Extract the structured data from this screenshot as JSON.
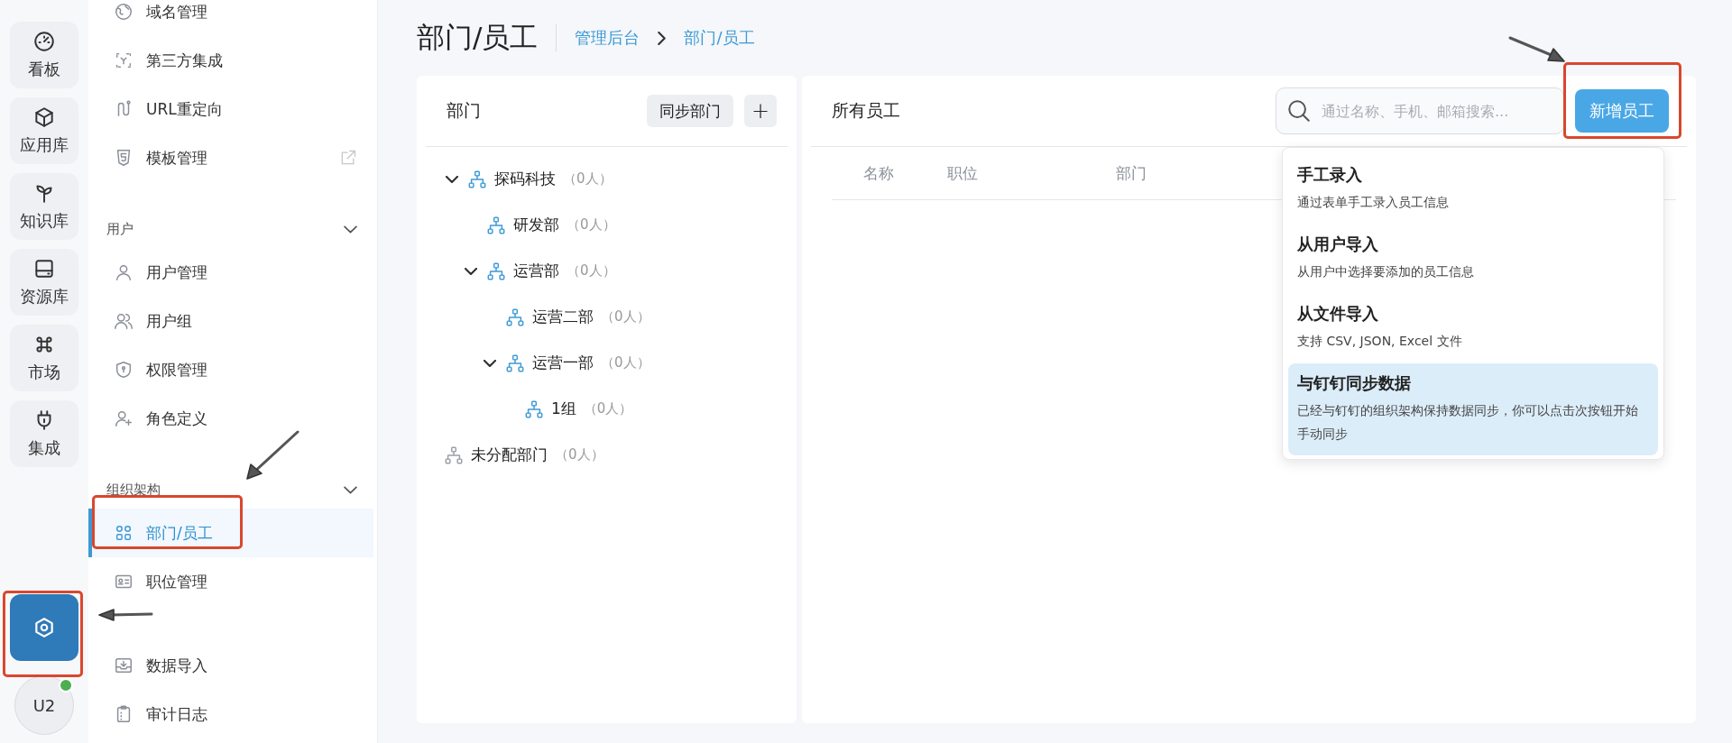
{
  "rail": {
    "items": [
      {
        "label": "看板",
        "selected": false
      },
      {
        "label": "应用库",
        "selected": false
      },
      {
        "label": "知识库",
        "selected": false
      },
      {
        "label": "资源库",
        "selected": false
      },
      {
        "label": "市场",
        "selected": false
      },
      {
        "label": "集成",
        "selected": false
      }
    ],
    "settings": {
      "selected": true
    },
    "avatar": {
      "initials": "U2",
      "online": true
    }
  },
  "sidebar": {
    "sections": [
      {
        "items": [
          {
            "label": "域名管理",
            "selected": false,
            "external": false
          },
          {
            "label": "第三方集成",
            "selected": false,
            "external": false
          },
          {
            "label": "URL重定向",
            "selected": false,
            "external": false
          },
          {
            "label": "模板管理",
            "selected": false,
            "external": true
          }
        ]
      },
      {
        "title": "用户",
        "expanded": true,
        "items": [
          {
            "label": "用户管理",
            "selected": false,
            "external": false
          },
          {
            "label": "用户组",
            "selected": false,
            "external": false
          },
          {
            "label": "权限管理",
            "selected": false,
            "external": false
          },
          {
            "label": "角色定义",
            "selected": false,
            "external": false
          }
        ]
      },
      {
        "title": "组织架构",
        "expanded": true,
        "items": [
          {
            "label": "部门/员工",
            "selected": true,
            "external": false
          },
          {
            "label": "职位管理",
            "selected": false,
            "external": false
          }
        ]
      },
      {
        "items": [
          {
            "label": "数据导入",
            "selected": false,
            "external": false
          },
          {
            "label": "审计日志",
            "selected": false,
            "external": false
          }
        ]
      }
    ]
  },
  "page": {
    "title": "部门/员工",
    "breadcrumb": [
      "管理后台",
      "部门/员工"
    ]
  },
  "departments": {
    "title": "部门",
    "sync_button": "同步部门",
    "add_button": "+",
    "tree": [
      {
        "kind": "department",
        "name": "探码科技",
        "count": "（0人）",
        "expanded": true,
        "children": [
          {
            "kind": "department",
            "name": "研发部",
            "count": "（0人）"
          },
          {
            "kind": "department",
            "name": "运营部",
            "count": "（0人）",
            "expanded": true,
            "children": [
              {
                "kind": "department",
                "name": "运营二部",
                "count": "（0人）"
              },
              {
                "kind": "department",
                "name": "运营一部",
                "count": "（0人）",
                "expanded": true,
                "children": [
                  {
                    "kind": "department",
                    "name": "1组",
                    "count": "（0人）"
                  }
                ]
              }
            ]
          }
        ]
      },
      {
        "kind": "unassigned",
        "name": "未分配部门",
        "count": "（0人）"
      }
    ]
  },
  "employees": {
    "title": "所有员工",
    "search": {
      "placeholder": "通过名称、手机、邮箱搜索..."
    },
    "add_button": "新增员工",
    "table": {
      "columns": [
        "名称",
        "职位",
        "部门"
      ]
    },
    "add_menu": [
      {
        "title": "手工录入",
        "description": "通过表单手工录入员工信息",
        "selected": false
      },
      {
        "title": "从用户导入",
        "description": "从用户中选择要添加的员工信息",
        "selected": false
      },
      {
        "title": "从文件导入",
        "description": "支持 CSV, JSON, Excel 文件",
        "selected": false
      },
      {
        "title": "与钉钉同步数据",
        "description": "已经与钉钉的组织架构保持数据同步，你可以点击次按钮开始手动同步",
        "selected": true
      }
    ]
  }
}
